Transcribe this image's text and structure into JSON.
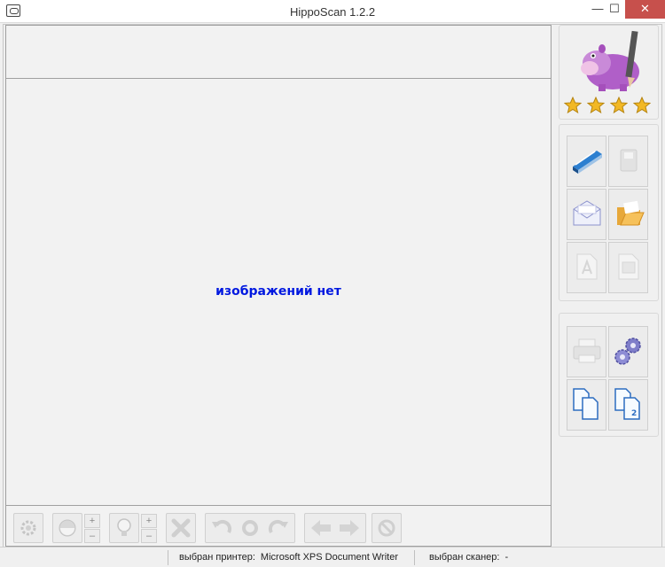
{
  "window": {
    "title": "HippoScan 1.2.2",
    "minimize_glyph": "—",
    "maximize_glyph": "☐",
    "close_glyph": "✕"
  },
  "viewer": {
    "empty_message": "изображений нет"
  },
  "toolbar": {
    "plus": "+",
    "minus": "–"
  },
  "statusbar": {
    "printer_label": "выбран принтер:",
    "printer_value": "Microsoft XPS Document Writer",
    "scanner_label": "выбран сканер:",
    "scanner_value": "-"
  },
  "colors": {
    "accent_text": "#0018e0",
    "close_button": "#c7504c",
    "star": "#f2b824"
  },
  "logo": {
    "rating": 4,
    "max_rating": 4
  }
}
